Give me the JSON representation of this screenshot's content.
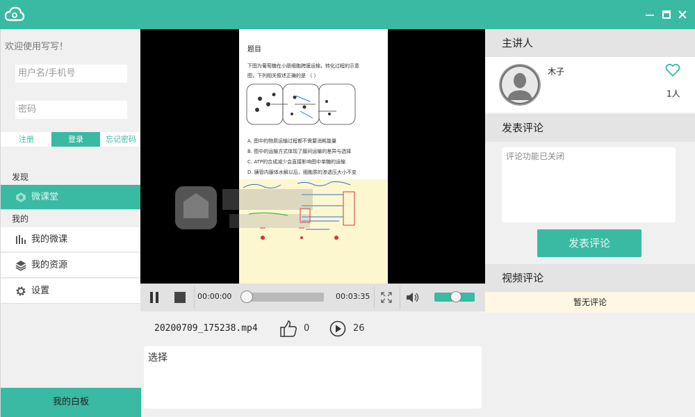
{
  "colors": {
    "accent": "#3ab9a3",
    "note_bg": "#fdf7d0",
    "no_comment_bg": "#fdf7e4"
  },
  "titlebar": {
    "logo_icon": "cloud-icon",
    "minimize_icon": "minimize-icon",
    "maximize_icon": "maximize-icon",
    "close_icon": "close-icon"
  },
  "sidebar": {
    "welcome": "欢迎使用写写！",
    "username_placeholder": "用户名/手机号",
    "password_placeholder": "密码",
    "register": "注册",
    "login": "登录",
    "forgot": "忘记密码",
    "discover_label": "发现",
    "micro_class": "微课堂",
    "mine_label": "我的",
    "my_micro_lessons": "我的微课",
    "my_resources": "我的资源",
    "settings": "设置",
    "whiteboard": "我的白板"
  },
  "document": {
    "title": "题目",
    "lines": [
      "下图为葡萄糖在小肠细胞跨膜运输，转化过程的示意",
      "图，下列相关叙述正确的是 （ ）",
      "A. 图中的物质运输过程都不需要消耗能量",
      "B. 图中的运输方式体现了膜间运输的差异与选择",
      "C. ATP的合成减少会直接影响图中单糖的运输",
      "D. 胰管内腺体水解以后，细胞质的渗透压大小不变"
    ]
  },
  "player": {
    "current_time": "00:00:00",
    "total_time": "00:03:35",
    "progress": 0,
    "volume": 0.55
  },
  "video_info": {
    "file_name": "20200709_175238.mp4",
    "likes": "0",
    "plays": "26",
    "description": "选择"
  },
  "right_panel": {
    "lecturer_header": "主讲人",
    "lecturer_name": "木子",
    "fans": "1人",
    "post_comment_header": "发表评论",
    "comment_placeholder": "评论功能已关闭",
    "submit_label": "发表评论",
    "video_comments_header": "视频评论",
    "no_comments": "暂无评论"
  }
}
